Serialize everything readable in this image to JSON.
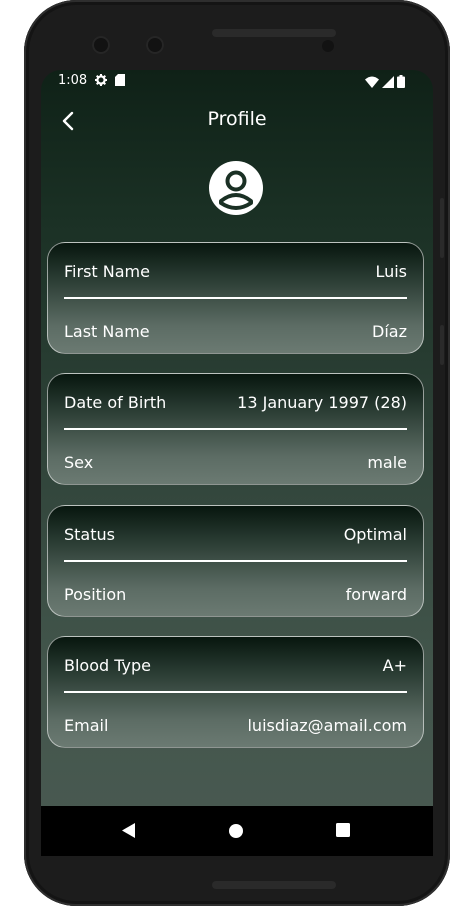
{
  "status_bar": {
    "time": "1:08",
    "icons_left": [
      "gear-icon",
      "sd-card-icon"
    ],
    "icons_right": [
      "wifi-icon",
      "signal-icon",
      "battery-icon"
    ]
  },
  "app_bar": {
    "title": "Profile",
    "back_icon": "chevron-left-icon"
  },
  "avatar_icon": "account-circle-icon",
  "cards": [
    {
      "rows": [
        {
          "label": "First Name",
          "value": "Luis"
        },
        {
          "label": "Last Name",
          "value": "Díaz"
        }
      ]
    },
    {
      "rows": [
        {
          "label": "Date of Birth",
          "value": "13 January 1997 (28)"
        },
        {
          "label": "Sex",
          "value": "male"
        }
      ]
    },
    {
      "rows": [
        {
          "label": "Status",
          "value": "Optimal"
        },
        {
          "label": "Position",
          "value": "forward"
        }
      ]
    },
    {
      "rows": [
        {
          "label": "Blood Type",
          "value": "A+"
        },
        {
          "label": "Email",
          "value": "luisdiaz@amail.com"
        }
      ]
    }
  ],
  "nav_bar": {
    "back": "triangle-back-icon",
    "home": "circle-home-icon",
    "recents": "square-recents-icon"
  }
}
